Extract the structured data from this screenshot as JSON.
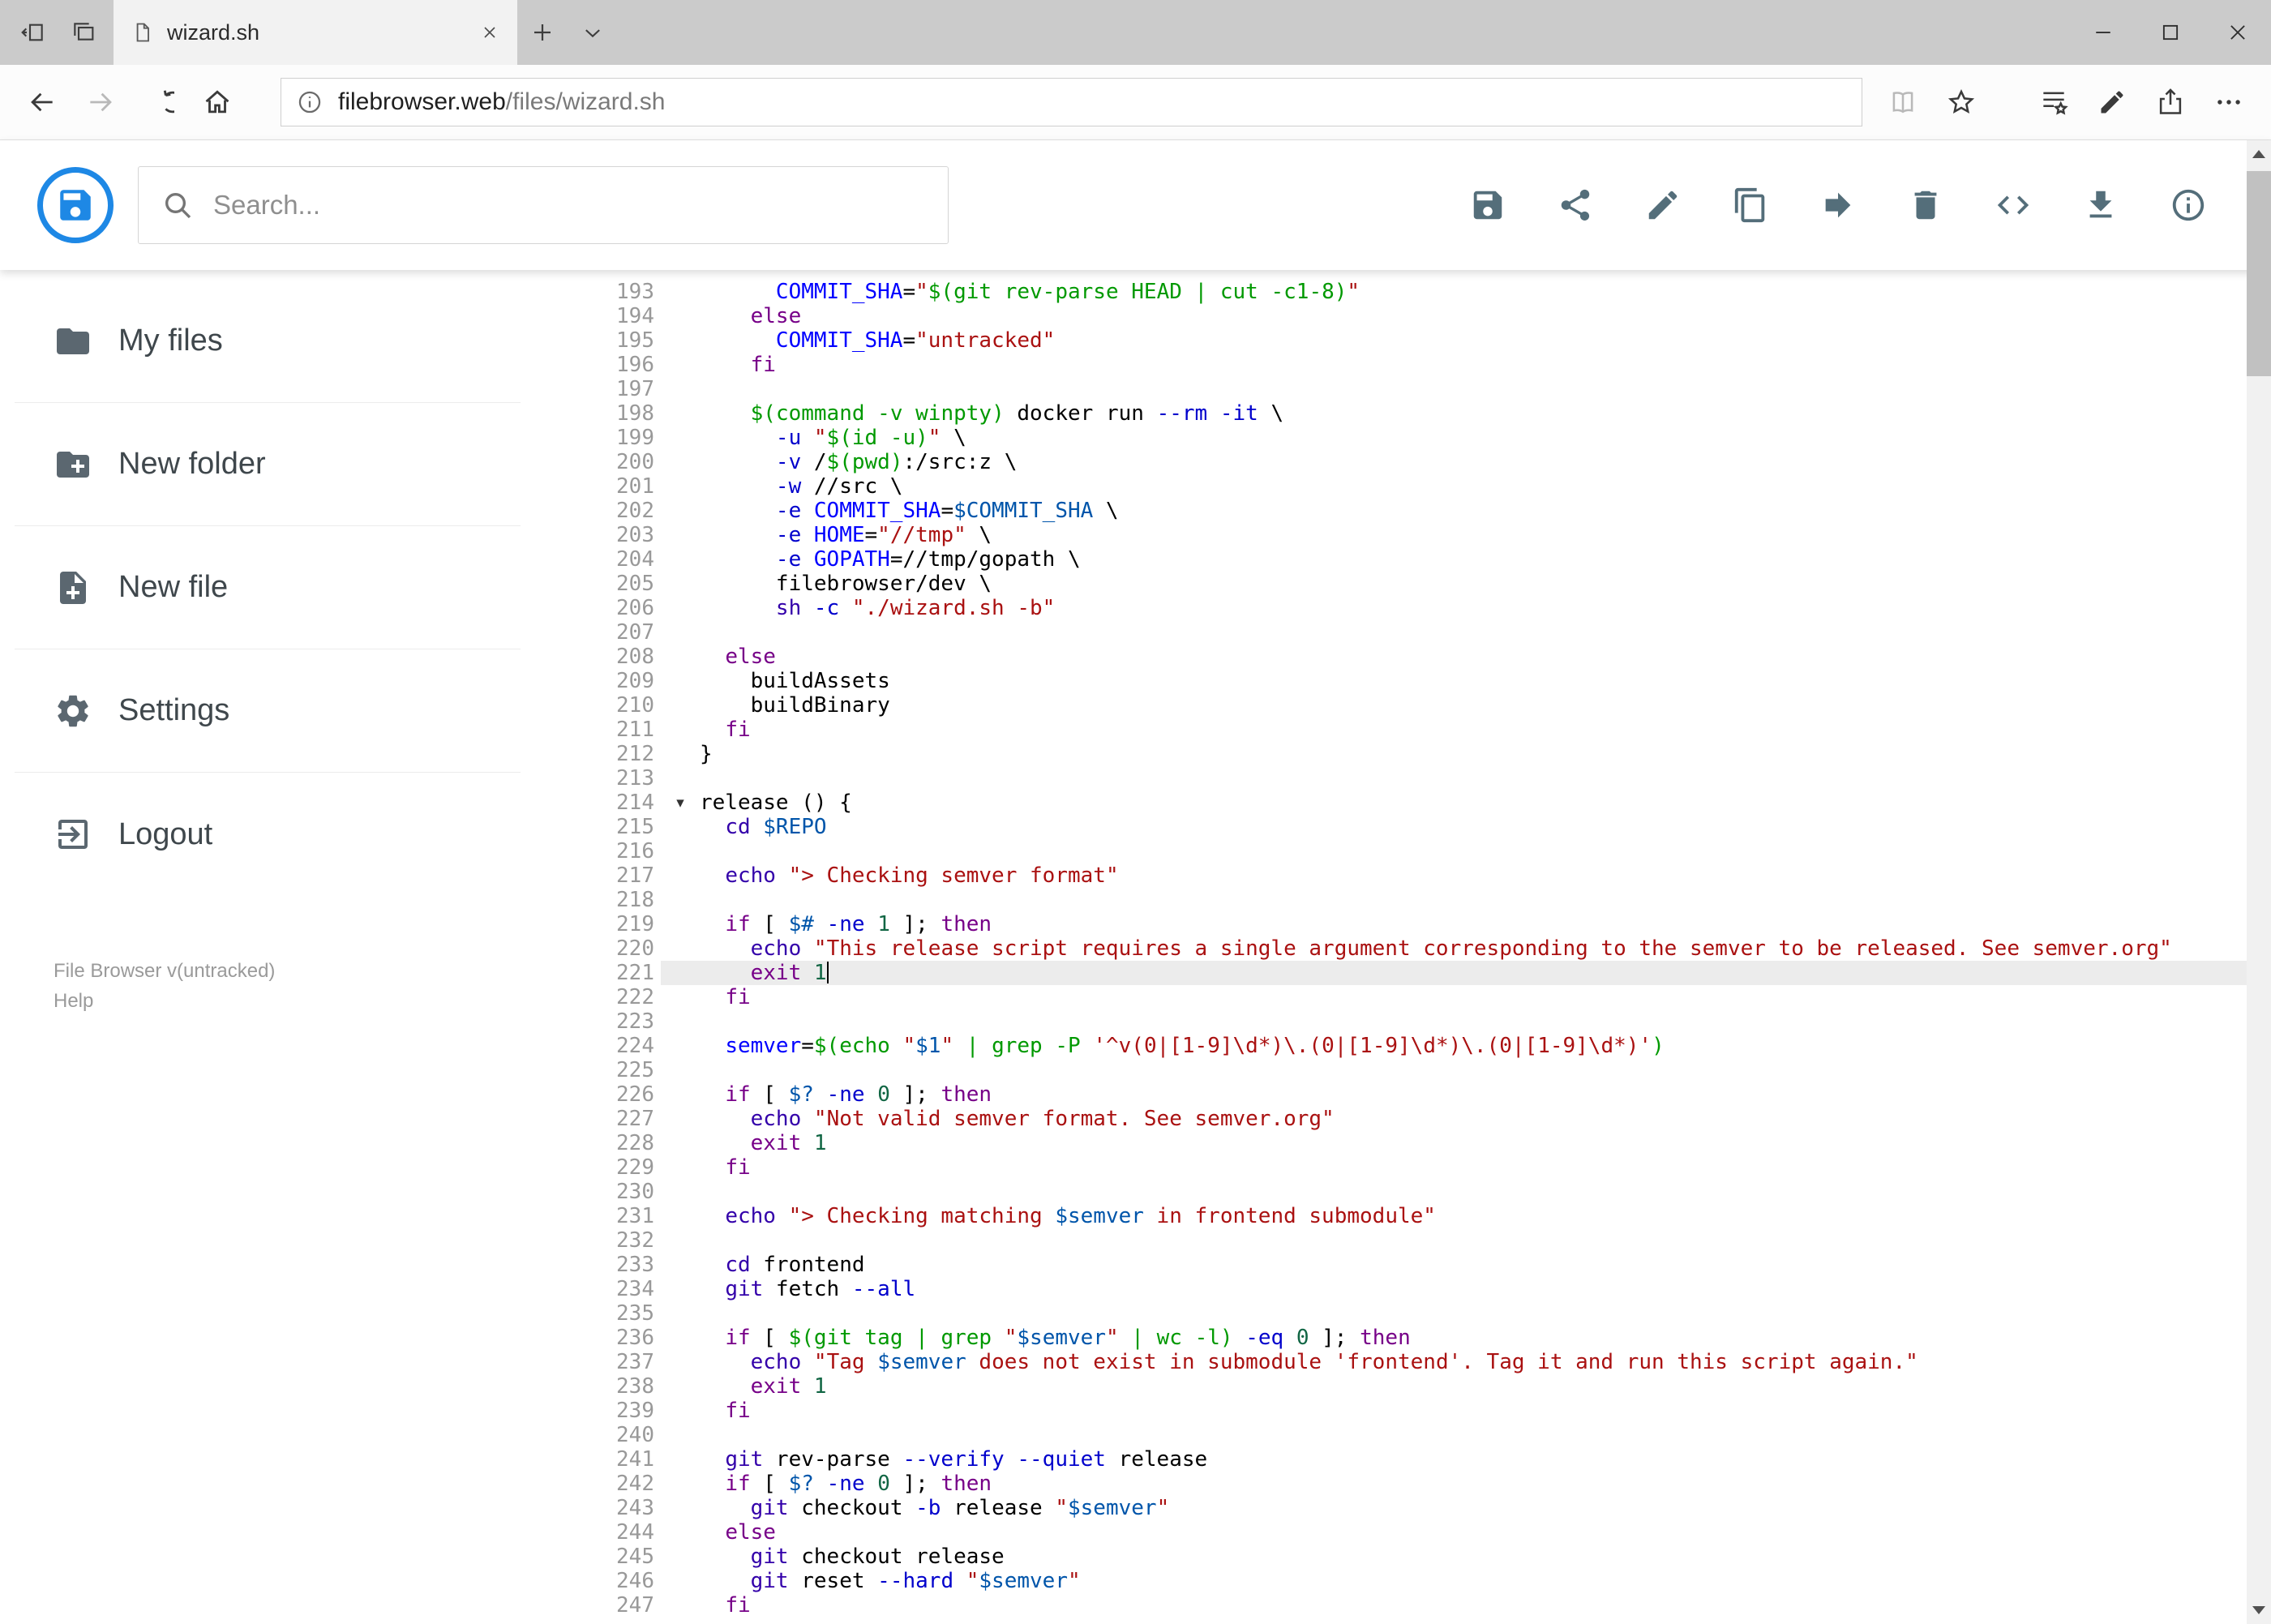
{
  "browser": {
    "tab": {
      "title": "wizard.sh"
    },
    "address": {
      "domain": "filebrowser.web",
      "path": "/files/wizard.sh"
    }
  },
  "app": {
    "header": {
      "search_placeholder": "Search...",
      "actions": [
        {
          "name": "save",
          "icon": "save-icon"
        },
        {
          "name": "share",
          "icon": "share-icon"
        },
        {
          "name": "rename",
          "icon": "pencil-icon"
        },
        {
          "name": "copy",
          "icon": "copy-icon"
        },
        {
          "name": "move",
          "icon": "move-icon"
        },
        {
          "name": "delete",
          "icon": "trash-icon"
        },
        {
          "name": "raw-view",
          "icon": "code-icon"
        },
        {
          "name": "download",
          "icon": "download-icon"
        },
        {
          "name": "info",
          "icon": "info-icon"
        }
      ]
    },
    "sidebar": {
      "items": [
        {
          "label": "My files",
          "icon": "folder-icon"
        },
        {
          "label": "New folder",
          "icon": "new-folder-icon"
        },
        {
          "label": "New file",
          "icon": "new-file-icon"
        },
        {
          "label": "Settings",
          "icon": "settings-icon"
        },
        {
          "label": "Logout",
          "icon": "logout-icon"
        }
      ],
      "footer": {
        "version": "File Browser v(untracked)",
        "help": "Help"
      }
    },
    "editor": {
      "first_line": 193,
      "active_line": 221,
      "cursor": {
        "line": 221,
        "column": 10
      },
      "fold_markers": [
        214
      ],
      "lines": [
        "      COMMIT_SHA=\"$(git rev-parse HEAD | cut -c1-8)\"",
        "    else",
        "      COMMIT_SHA=\"untracked\"",
        "    fi",
        "",
        "    $(command -v winpty) docker run --rm -it \\",
        "      -u \"$(id -u)\" \\",
        "      -v /$(pwd):/src:z \\",
        "      -w //src \\",
        "      -e COMMIT_SHA=$COMMIT_SHA \\",
        "      -e HOME=\"//tmp\" \\",
        "      -e GOPATH=//tmp/gopath \\",
        "      filebrowser/dev \\",
        "      sh -c \"./wizard.sh -b\"",
        "",
        "  else",
        "    buildAssets",
        "    buildBinary",
        "  fi",
        "}",
        "",
        "release () {",
        "  cd $REPO",
        "",
        "  echo \"> Checking semver format\"",
        "",
        "  if [ $# -ne 1 ]; then",
        "    echo \"This release script requires a single argument corresponding to the semver to be released. See semver.org\"",
        "    exit 1",
        "  fi",
        "",
        "  semver=$(echo \"$1\" | grep -P '^v(0|[1-9]\\d*)\\.(0|[1-9]\\d*)\\.(0|[1-9]\\d*)')",
        "",
        "  if [ $? -ne 0 ]; then",
        "    echo \"Not valid semver format. See semver.org\"",
        "    exit 1",
        "  fi",
        "",
        "  echo \"> Checking matching $semver in frontend submodule\"",
        "",
        "  cd frontend",
        "  git fetch --all",
        "",
        "  if [ $(git tag | grep \"$semver\" | wc -l) -eq 0 ]; then",
        "    echo \"Tag $semver does not exist in submodule 'frontend'. Tag it and run this script again.\"",
        "    exit 1",
        "  fi",
        "",
        "  git rev-parse --verify --quiet release",
        "  if [ $? -ne 0 ]; then",
        "    git checkout -b release \"$semver\"",
        "  else",
        "    git checkout release",
        "    git reset --hard \"$semver\"",
        "  fi"
      ]
    }
  }
}
